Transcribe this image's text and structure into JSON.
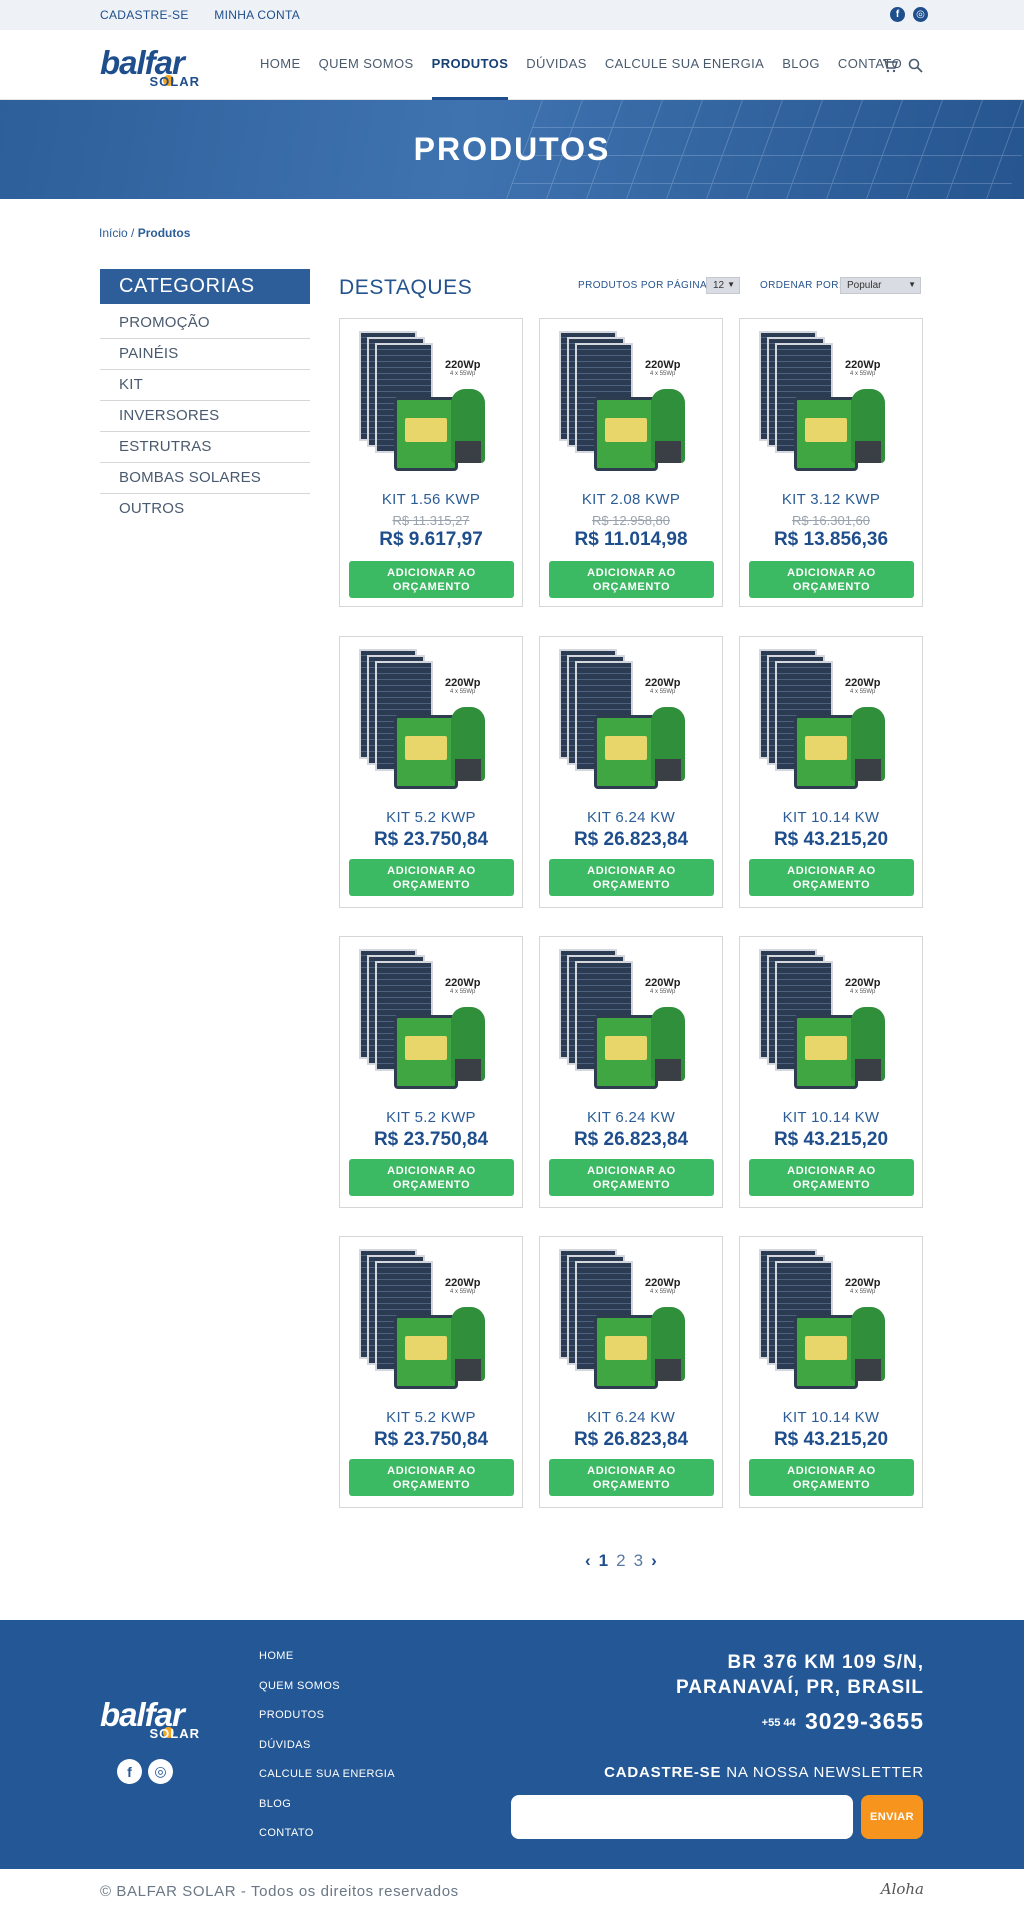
{
  "topbar": {
    "links": [
      "CADASTRE-SE",
      "MINHA CONTA"
    ],
    "social_icons": [
      "facebook-icon",
      "instagram-icon"
    ]
  },
  "logo": {
    "main": "balfar",
    "sub": "SOLAR"
  },
  "nav": {
    "items": [
      "HOME",
      "QUEM SOMOS",
      "PRODUTOS",
      "DÚVIDAS",
      "CALCULE SUA ENERGIA",
      "BLOG",
      "CONTATO"
    ],
    "active": "PRODUTOS",
    "icons": [
      "cart-icon",
      "search-icon"
    ]
  },
  "hero": {
    "title": "PRODUTOS"
  },
  "breadcrumb": {
    "home": "Início",
    "sep": " / ",
    "current": "Produtos"
  },
  "sidebar": {
    "title": "CATEGORIAS",
    "items": [
      "PROMOÇÃO",
      "PAINÉIS",
      "KIT",
      "INVERSORES",
      "ESTRUTRAS",
      "BOMBAS SOLARES",
      "OUTROS"
    ]
  },
  "listing": {
    "title": "DESTAQUES",
    "per_page_label": "PRODUTOS POR PÁGINA:",
    "per_page_value": "12",
    "sort_label": "ORDENAR POR:",
    "sort_value": "Popular"
  },
  "product_image_text": {
    "power": "220Wp",
    "detail": "4 x 55Wp"
  },
  "products": [
    {
      "name": "KIT 1.56 KWP",
      "old_price": "R$ 11.315,27",
      "price": "R$ 9.617,97",
      "button": "ADICIONAR AO ORÇAMENTO"
    },
    {
      "name": "KIT 2.08 KWP",
      "old_price": "R$ 12.958,80",
      "price": "R$ 11.014,98",
      "button": "ADICIONAR AO ORÇAMENTO"
    },
    {
      "name": "KIT 3.12 KWP",
      "old_price": "R$ 16.301,60",
      "price": "R$ 13.856,36",
      "button": "ADICIONAR AO ORÇAMENTO"
    },
    {
      "name": "KIT 5.2 KWP",
      "old_price": "",
      "price": "R$ 23.750,84",
      "button": "ADICIONAR AO ORÇAMENTO"
    },
    {
      "name": "KIT 6.24 KW",
      "old_price": "",
      "price": "R$ 26.823,84",
      "button": "ADICIONAR AO ORÇAMENTO"
    },
    {
      "name": "KIT 10.14 KW",
      "old_price": "",
      "price": "R$ 43.215,20",
      "button": "ADICIONAR AO ORÇAMENTO"
    },
    {
      "name": "KIT 5.2 KWP",
      "old_price": "",
      "price": "R$ 23.750,84",
      "button": "ADICIONAR AO ORÇAMENTO"
    },
    {
      "name": "KIT 6.24 KW",
      "old_price": "",
      "price": "R$ 26.823,84",
      "button": "ADICIONAR AO ORÇAMENTO"
    },
    {
      "name": "KIT 10.14 KW",
      "old_price": "",
      "price": "R$ 43.215,20",
      "button": "ADICIONAR AO ORÇAMENTO"
    },
    {
      "name": "KIT 5.2 KWP",
      "old_price": "",
      "price": "R$ 23.750,84",
      "button": "ADICIONAR AO ORÇAMENTO"
    },
    {
      "name": "KIT 6.24 KW",
      "old_price": "",
      "price": "R$ 26.823,84",
      "button": "ADICIONAR AO ORÇAMENTO"
    },
    {
      "name": "KIT 10.14 KW",
      "old_price": "",
      "price": "R$ 43.215,20",
      "button": "ADICIONAR AO ORÇAMENTO"
    }
  ],
  "pagination": {
    "prev": "‹",
    "pages": [
      "1",
      "2",
      "3"
    ],
    "current": "1",
    "next": "›"
  },
  "footer": {
    "nav": [
      "HOME",
      "QUEM SOMOS",
      "PRODUTOS",
      "DÚVIDAS",
      "CALCULE SUA ENERGIA",
      "BLOG",
      "CONTATO"
    ],
    "address_line1": "BR 376 KM 109 S/N,",
    "address_line2": "PARANAVAÍ, PR, BRASIL",
    "phone_prefix": "+55 44",
    "phone": "3029-3655",
    "newsletter_bold": "CADASTRE-SE",
    "newsletter_rest": " NA NOSSA NEWSLETTER",
    "newsletter_placeholder": "",
    "newsletter_button": "ENVIAR",
    "social_icons": [
      "facebook-icon",
      "instagram-icon"
    ]
  },
  "copyright": "© BALFAR SOLAR - Todos os direitos reservados",
  "credit": "Aloha",
  "colors": {
    "primary": "#245795",
    "green": "#3cb963",
    "orange": "#f7941d",
    "topbar": "#eef2f7"
  }
}
